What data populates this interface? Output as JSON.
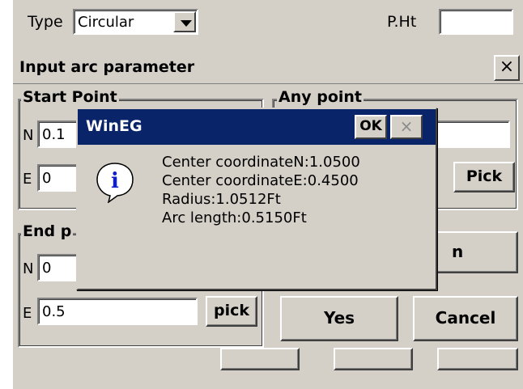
{
  "top": {
    "type_label": "Type",
    "type_value": "Circular",
    "pht_label": "P.Ht",
    "pht_value": ""
  },
  "dialog": {
    "title": "Input arc parameter",
    "close_glyph": "×",
    "start_point": {
      "label": "Start Point",
      "n_label": "N",
      "n_value": "0.1",
      "e_label": "E",
      "e_value": "0"
    },
    "any_point": {
      "label": "Any point",
      "pick_label": "Pick"
    },
    "end_point": {
      "label": "End p",
      "n_label": "N",
      "n_value": "0",
      "e_label": "E",
      "e_value": "0.5",
      "pick_label": "pick"
    },
    "partial_button_label": "n",
    "yes_label": "Yes",
    "cancel_label": "Cancel"
  },
  "message_box": {
    "title": "WinEG",
    "ok_label": "OK",
    "close_glyph": "×",
    "lines": [
      "Center coordinateN:1.0500",
      "Center coordinateE:0.4500",
      "Radius:1.0512Ft",
      "Arc length:0.5150Ft"
    ],
    "icon": "info-icon",
    "colors": {
      "title_bar": "#0a246a",
      "icon_blue": "#1020c8"
    }
  }
}
